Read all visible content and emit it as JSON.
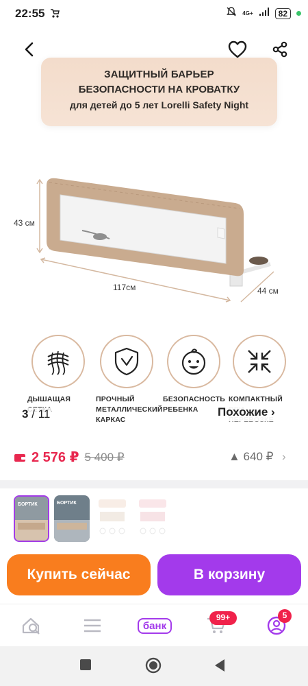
{
  "status": {
    "time": "22:55",
    "network": "4G+",
    "battery": "82"
  },
  "hero": {
    "line1": "ЗАЩИТНЫЙ БАРЬЕР",
    "line2": "БЕЗОПАСНОСТИ НА КРОВАТКУ",
    "line3": "для детей до 5 лет Lorelli Safety Night"
  },
  "dimensions": {
    "height": "43 см",
    "length": "117см",
    "depth": "44 см"
  },
  "features": [
    {
      "label_1": "ДЫШАЩАЯ",
      "label_2": "СЕТКА",
      "icon": "breathable-mesh-icon"
    },
    {
      "label_1": "ПРОЧНЫЙ",
      "label_2": "МЕТАЛЛИЧЕСКИЙ",
      "label_3": "КАРКАС",
      "icon": "shield-icon"
    },
    {
      "label_1": "БЕЗОПАСНОСТЬ",
      "label_2": "РЕБЕНКА",
      "icon": "baby-face-icon"
    },
    {
      "label_1": "КОМПАКТНЫЙ",
      "label_2": "ПРИ ПЕРЕВОЗКЕ",
      "icon": "compress-arrows-icon"
    }
  ],
  "gallery": {
    "current": "3",
    "total": "/ 11",
    "similar_label": "Похожие ›",
    "thumb_label": "БОРТИК"
  },
  "price": {
    "current": "2 576 ₽",
    "old": "5 400 ₽",
    "delta": "▲ 640 ₽"
  },
  "actions": {
    "buy_now": "Купить сейчас",
    "add_to_cart": "В корзину"
  },
  "nav": {
    "bank": "банк",
    "cart_badge": "99+",
    "profile_badge": "5"
  },
  "colors": {
    "accent": "#a33aeb",
    "buy": "#f97d1e",
    "price": "#e8284f"
  }
}
